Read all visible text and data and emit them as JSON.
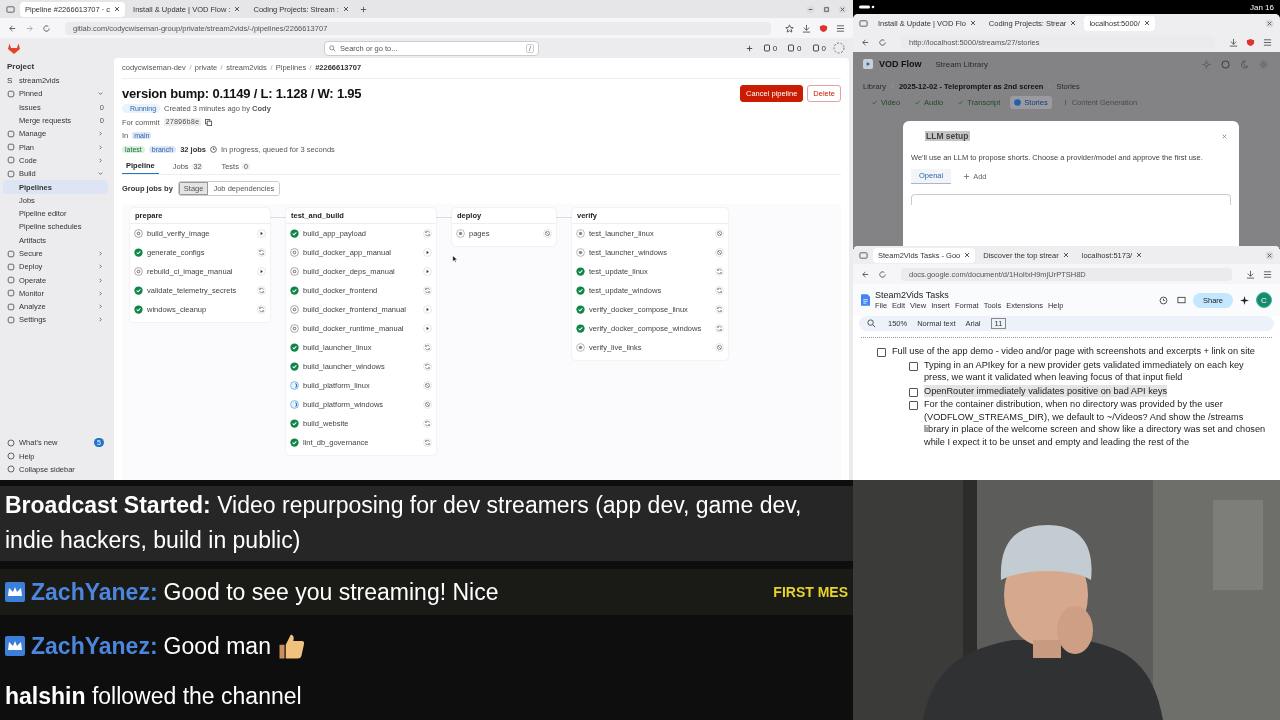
{
  "system_bar": {
    "date": "Jan 16"
  },
  "gitlab_window": {
    "tabs": [
      {
        "label": "Pipeline #2266613707 · c",
        "selected": true
      },
      {
        "label": "Install & Update | VOD Flow :",
        "selected": false
      },
      {
        "label": "Coding Projects: Stream :",
        "selected": false
      }
    ],
    "url": "gitlab.com/codycwiseman-group/private/stream2vids/-/pipelines/2266613707",
    "search": {
      "placeholder": "Search or go to...",
      "shortcut": "/"
    },
    "header_counts": [
      "0",
      "0",
      "0"
    ],
    "sidebar": {
      "heading": "Project",
      "project_initial": "S",
      "project": "stream2vids",
      "items": [
        {
          "label": "Pinned",
          "expanded": true,
          "children": [
            {
              "label": "Issues",
              "count": "0",
              "selected": false
            },
            {
              "label": "Merge requests",
              "count": "0",
              "selected": false
            }
          ]
        },
        {
          "label": "Manage",
          "expanded": false
        },
        {
          "label": "Plan",
          "expanded": false
        },
        {
          "label": "Code",
          "expanded": false
        },
        {
          "label": "Build",
          "expanded": true,
          "children": [
            {
              "label": "Pipelines",
              "selected": true
            },
            {
              "label": "Jobs",
              "selected": false
            },
            {
              "label": "Pipeline editor",
              "selected": false
            },
            {
              "label": "Pipeline schedules",
              "selected": false
            },
            {
              "label": "Artifacts",
              "selected": false
            }
          ]
        },
        {
          "label": "Secure",
          "expanded": false
        },
        {
          "label": "Deploy",
          "expanded": false
        },
        {
          "label": "Operate",
          "expanded": false
        },
        {
          "label": "Monitor",
          "expanded": false
        },
        {
          "label": "Analyze",
          "expanded": false
        },
        {
          "label": "Settings",
          "expanded": false
        }
      ],
      "footer": [
        {
          "label": "What's new",
          "badge": "5"
        },
        {
          "label": "Help"
        },
        {
          "label": "Collapse sidebar"
        }
      ]
    },
    "breadcrumbs": [
      "codycwiseman-dev",
      "private",
      "stream2vids",
      "Pipelines",
      "#2266613707"
    ],
    "title": "version bump: 0.1149 / L: 1.128 / W: 1.95",
    "status": "Running",
    "created": "Created 3 minutes ago by **Cody**",
    "commit_label": "For commit",
    "commit": "27896b8e",
    "ref_label": "In",
    "ref": "main",
    "badges": [
      "latest",
      "branch"
    ],
    "jobs_count": "32 jobs",
    "progress": "In progress, queued for 3 seconds",
    "actions": [
      {
        "label": "Cancel pipeline",
        "kind": "danger"
      },
      {
        "label": "Delete",
        "kind": "outline"
      }
    ],
    "page_tabs": [
      {
        "label": "Pipeline",
        "selected": true
      },
      {
        "label": "Jobs",
        "count": "32",
        "selected": false
      },
      {
        "label": "Tests",
        "count": "0",
        "selected": false
      }
    ],
    "group_by": {
      "label": "Group jobs by",
      "options": [
        {
          "label": "Stage",
          "selected": true
        },
        {
          "label": "Job dependencies",
          "selected": false
        }
      ]
    },
    "stages": [
      {
        "name": "prepare",
        "jobs": [
          {
            "name": "build_verify_image",
            "kind": "manual"
          },
          {
            "name": "generate_configs",
            "kind": "success"
          },
          {
            "name": "rebuild_ci_image_manual",
            "kind": "manual"
          },
          {
            "name": "validate_telemetry_secrets",
            "kind": "success"
          },
          {
            "name": "windows_cleanup",
            "kind": "success"
          }
        ]
      },
      {
        "name": "test_and_build",
        "jobs": [
          {
            "name": "build_app_payload",
            "kind": "success"
          },
          {
            "name": "build_docker_app_manual",
            "kind": "manual"
          },
          {
            "name": "build_docker_deps_manual",
            "kind": "manual"
          },
          {
            "name": "build_docker_frontend",
            "kind": "success"
          },
          {
            "name": "build_docker_frontend_manual",
            "kind": "manual"
          },
          {
            "name": "build_docker_runtime_manual",
            "kind": "manual"
          },
          {
            "name": "build_launcher_linux",
            "kind": "success"
          },
          {
            "name": "build_launcher_windows",
            "kind": "success"
          },
          {
            "name": "build_platform_linux",
            "kind": "running"
          },
          {
            "name": "build_platform_windows",
            "kind": "running"
          },
          {
            "name": "build_website",
            "kind": "success"
          },
          {
            "name": "lint_db_governance",
            "kind": "success"
          }
        ]
      },
      {
        "name": "deploy",
        "jobs": [
          {
            "name": "pages",
            "kind": "created"
          }
        ]
      },
      {
        "name": "verify",
        "jobs": [
          {
            "name": "test_launcher_linux",
            "kind": "created"
          },
          {
            "name": "test_launcher_windows",
            "kind": "created"
          },
          {
            "name": "test_update_linux",
            "kind": "success"
          },
          {
            "name": "test_update_windows",
            "kind": "success"
          },
          {
            "name": "verify_docker_compose_linux",
            "kind": "success"
          },
          {
            "name": "verify_docker_compose_windows",
            "kind": "success"
          },
          {
            "name": "verify_live_links",
            "kind": "created"
          }
        ]
      }
    ]
  },
  "vod_window": {
    "tabs": [
      {
        "label": "Install & Update | VOD Flo",
        "selected": false
      },
      {
        "label": "Coding Projects: Strear",
        "selected": false
      },
      {
        "label": "localhost:5000/",
        "selected": true
      }
    ],
    "url": "http://localhost:5000/streams/27/stories",
    "app_name": "VOD Flow",
    "nav": "Stream Library",
    "breadcrumbs": [
      "Library",
      "2025-12-02 - Teleprompter as 2nd screen",
      "Stories"
    ],
    "steps": [
      {
        "label": "Video",
        "kind": "done"
      },
      {
        "label": "Audio",
        "kind": "done"
      },
      {
        "label": "Transcript",
        "kind": "done"
      },
      {
        "label": "Stories",
        "kind": "current"
      },
      {
        "label": "Content Generation",
        "kind": "locked"
      }
    ],
    "modal": {
      "title": "LLM setup",
      "description": "We'll use an LLM to propose shorts. Choose a provider/model and approve the first use.",
      "tabs": [
        {
          "label": "Openai",
          "selected": true
        }
      ],
      "add": "Add"
    }
  },
  "docs_window": {
    "tabs": [
      {
        "label": "Steam2Vids Tasks - Goo",
        "selected": true
      },
      {
        "label": "Discover the top strear",
        "selected": false
      },
      {
        "label": "localhost:5173/",
        "selected": false
      }
    ],
    "url": "docs.google.com/document/d/1HoItxH9mjUrPTSH8D",
    "doc_title": "Steam2Vids Tasks",
    "menu": [
      "File",
      "Edit",
      "View",
      "Insert",
      "Format",
      "Tools",
      "Extensions",
      "Help"
    ],
    "share": "Share",
    "avatar": "C",
    "toolbar": {
      "zoom": "150%",
      "style": "Normal text",
      "font": "Arial",
      "size": "11"
    },
    "checklist": [
      {
        "text": "Full use of the app demo - video and/or page with screenshots and excerpts + link on site",
        "checked": false,
        "highlighted": false,
        "children": [
          {
            "text": "Typing in an APIkey for a new provider gets validated immediately on each key press, we want it validated when leaving focus of that input field",
            "checked": false,
            "highlighted": false
          },
          {
            "text": "OpenRouter immediately validates positive on bad API keys",
            "checked": false,
            "highlighted": true
          },
          {
            "text": "For the container distribution, when no directory was provided by the user (VODFLOW_STREAMS_DIR), we default to ~/Videos? And show the /streams library in place of the welcome screen and show like a directory was set and chosen while I expect it to be unset and empty and leading the rest of the",
            "checked": false,
            "highlighted": false
          }
        ]
      }
    ]
  },
  "chat": {
    "lines": [
      {
        "kind": "broadcast",
        "text": "**Broadcast Started:** Video repurposing for dev streamers (app dev, game dev, indie hackers, build in public)"
      },
      {
        "kind": "message",
        "user": "ZachYanez:",
        "text": "Good to see you streaming! Nice",
        "tag": "FIRST MES",
        "emote": false
      },
      {
        "kind": "message",
        "user": "ZachYanez:",
        "text": "Good man",
        "emote": true
      },
      {
        "kind": "event",
        "text": "**halshin** followed the channel"
      }
    ]
  }
}
